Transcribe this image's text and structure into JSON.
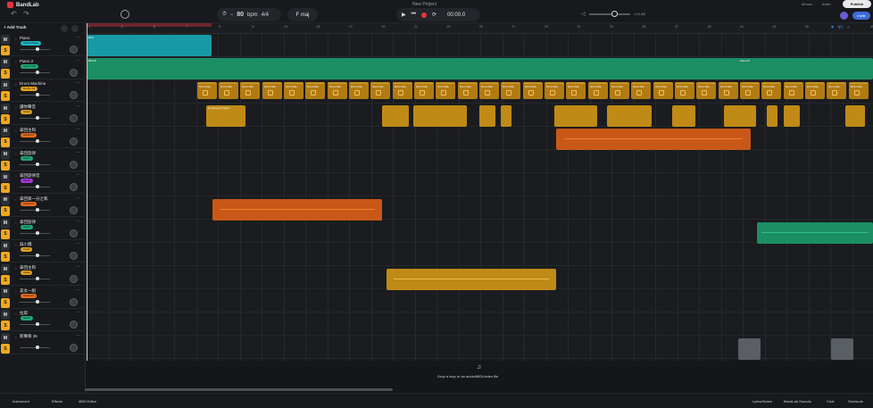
{
  "app": {
    "brand": "BandLab",
    "project_title": "New Project"
  },
  "header": {
    "tempo": "80",
    "tempo_unit": "bpm",
    "time_signature": "4/4",
    "key": "F maj",
    "time": "00:00.0",
    "volume_db": "-0.0 dB",
    "autosave": "All sav..",
    "invite": "Invite",
    "publish": "Publish",
    "share": "Invite"
  },
  "left": {
    "add_track": "+ Add Track",
    "tracks": [
      {
        "name": "Piano",
        "tag": "Grand Piano",
        "tag_color": "#21b5c2"
      },
      {
        "name": "Piano 2",
        "tag": "Synth Pad",
        "tag_color": "#22a877"
      },
      {
        "name": "Drum Machine",
        "tag": "Kit Pro Kit",
        "tag_color": "#e2a21d"
      },
      {
        "name": "讀你聲音",
        "tag": "Vocal",
        "tag_color": "#e2a21d"
      },
      {
        "name": "拿回主和",
        "tag": "Vocal FX",
        "tag_color": "#e66b1c"
      },
      {
        "name": "拿回旋律",
        "tag": "Synth",
        "tag_color": "#22a877"
      },
      {
        "name": "拿回旋律音",
        "tag": "Synth",
        "tag_color": "#a23ad8"
      },
      {
        "name": "拿回第一分之和",
        "tag": "Vocal FX",
        "tag_color": "#e66b1c"
      },
      {
        "name": "拿回旋律",
        "tag": "Synth",
        "tag_color": "#22a877"
      },
      {
        "name": "與小橋",
        "tag": "Vocal",
        "tag_color": "#e2a21d"
      },
      {
        "name": "拿回主和",
        "tag": "Vocal",
        "tag_color": "#e2a21d"
      },
      {
        "name": "美女一組",
        "tag": "Vocal FX",
        "tag_color": "#e66b1c"
      },
      {
        "name": "拉耶",
        "tag": "Synth",
        "tag_color": "#22a877"
      },
      {
        "name": "新樂章 36",
        "tag": "",
        "tag_color": "#6e7278"
      }
    ]
  },
  "ruler": {
    "numbers": [
      "1",
      "3",
      "5",
      "7",
      "9",
      "11",
      "13",
      "15",
      "17",
      "19",
      "21",
      "23",
      "25",
      "27",
      "29",
      "31",
      "33",
      "35",
      "37",
      "39",
      "41",
      "43",
      "45",
      "47",
      "49"
    ]
  },
  "clips": {
    "piano": "BFS",
    "piano2_a": "BFS B",
    "piano2_b": "Piano B",
    "drum": "Drum Ma..",
    "vocal_clip": "DongFeng Project"
  },
  "drop_zone": {
    "text": "Drop a loop or an audio/MIDI/video file"
  },
  "bottom": {
    "instrument": "Instrument",
    "effects": "Effects",
    "midi_editor": "MIDI Editor",
    "lyrics": "Lyrics/Notes",
    "bandlab_sounds": "BandLab Sounds",
    "chat": "Chat",
    "shortcuts": "Shortcuts"
  },
  "colors": {
    "accent": "#f0a81d",
    "teal": "#21b5c2",
    "green": "#22a877",
    "orange": "#e66b1c",
    "red": "#e5353b"
  }
}
